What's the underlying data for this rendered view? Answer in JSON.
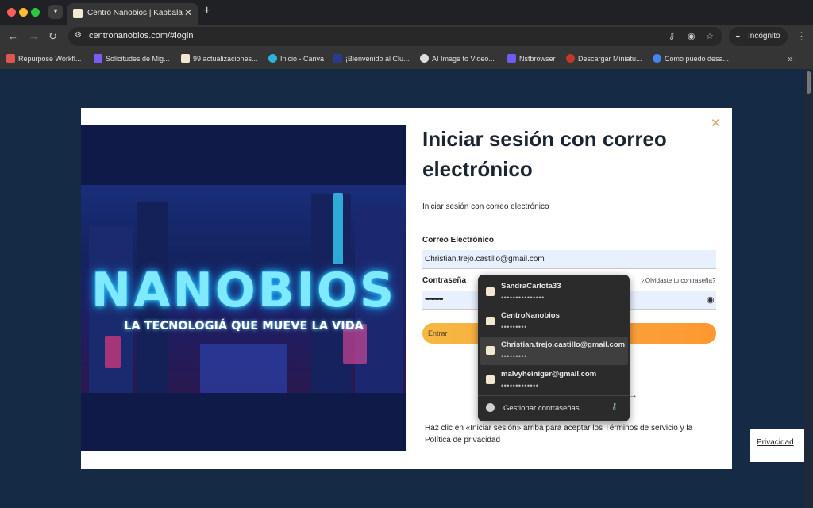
{
  "browser": {
    "tab_title": "Centro Nanobios | Kabbalah y Tecnología",
    "tab_close": "✕",
    "new_tab": "+",
    "url": "centronanobios.com/#login",
    "incognito_label": "Incógnito",
    "bookmarks": [
      {
        "label": "Repurpose Workfl...",
        "color": "#e0564e"
      },
      {
        "label": "Solicitudes de Mig...",
        "color": "#7b5cf0"
      },
      {
        "label": "99 actualizaciones...",
        "color": "#f1e8cf"
      },
      {
        "label": "Inicio - Canva",
        "color": "#2bb4d8"
      },
      {
        "label": "¡Bienvenido al Clu...",
        "color": "#2b3a8c"
      },
      {
        "label": "AI Image to Video...",
        "color": "#dddddd"
      },
      {
        "label": "Nstbrowser",
        "color": "#6e5df5"
      },
      {
        "label": "Descargar Miniatu...",
        "color": "#c0392b"
      },
      {
        "label": "Como puedo desa...",
        "color": "#4285f4"
      }
    ],
    "bookmarks_more": "»"
  },
  "hero": {
    "brand": "NANOBIOS",
    "tagline": "LA TECNOLOGIÁ QUE MUEVE LA VIDA"
  },
  "login": {
    "close": "✕",
    "title": "Iniciar sesión con correo electrónico",
    "subtitle": "Iniciar sesión con correo electrónico",
    "email_label": "Correo Electrónico",
    "email_value": "Christian.trejo.castillo@gmail.com",
    "password_label": "Contraseña",
    "forgot_link": "¿Olvidaste tu contraseña?",
    "password_value": "•••••••••",
    "enter_button": "Entrar",
    "arrow": "→",
    "terms": "Haz clic en «Iniciar sesión» arriba para aceptar los Términos de servicio y la Política de privacidad"
  },
  "autofill": {
    "items": [
      {
        "username": "SandraCarlota33",
        "password": "•••••••••••••••"
      },
      {
        "username": "CentroNanobios",
        "password": "•••••••••"
      },
      {
        "username": "Christian.trejo.castillo@gmail.com",
        "password": "•••••••••"
      },
      {
        "username": "malvyheiniger@gmail.com",
        "password": "•••••••••••••"
      }
    ],
    "selected_index": 2,
    "manage_label": "Gestionar contraseñas..."
  },
  "privacy_badge": "Privacidad"
}
